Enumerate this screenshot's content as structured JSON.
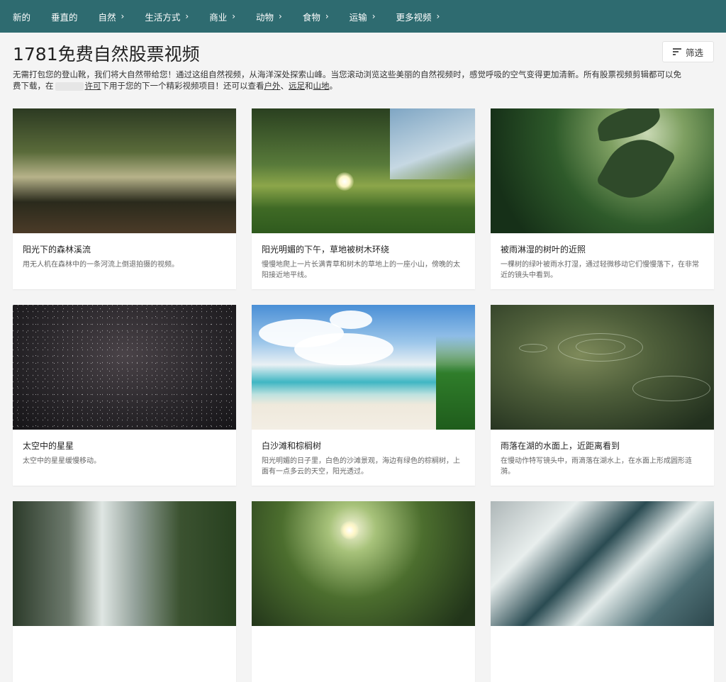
{
  "nav": {
    "items": [
      {
        "label": "新的",
        "has_chevron": false
      },
      {
        "label": "垂直的",
        "has_chevron": false
      },
      {
        "label": "自然",
        "has_chevron": true
      },
      {
        "label": "生活方式",
        "has_chevron": true
      },
      {
        "label": "商业",
        "has_chevron": true
      },
      {
        "label": "动物",
        "has_chevron": true
      },
      {
        "label": "食物",
        "has_chevron": true
      },
      {
        "label": "运输",
        "has_chevron": true
      },
      {
        "label": "更多视频",
        "has_chevron": true
      }
    ],
    "chevron_glyph": "›"
  },
  "header": {
    "title": "1781免费自然股票视频",
    "filter_label": "筛选",
    "filter_icon": "filter-lines-icon"
  },
  "description": {
    "text1": "无需打包您的登山靴，我们将大自然带给您！通过这组自然视频，从海洋深处探索山峰。当您滚动浏览这些美丽的自然视频时，感觉呼吸的空气变得更加清新。所有股票视频剪辑都可以免费下载，在",
    "link_license": "许可",
    "text2": "下用于您的下一个精彩视频项目！还可以查看",
    "link_outdoor": "户外",
    "sep1": "、",
    "link_hiking": "远足",
    "and": "和",
    "link_mountain": "山地",
    "end": "。"
  },
  "cards": [
    {
      "title": "阳光下的森林溪流",
      "desc": "用无人机在森林中的一条河流上倒退拍摄的视频。"
    },
    {
      "title": "阳光明媚的下午，草地被树木环绕",
      "desc": "慢慢地爬上一片长满青草和树木的草地上的一座小山，傍晚的太阳接近地平线。"
    },
    {
      "title": "被雨淋湿的树叶的近照",
      "desc": "一棵树的绿叶被雨水打湿，通过轻微移动它们慢慢落下，在非常近的镜头中看到。"
    },
    {
      "title": "太空中的星星",
      "desc": "太空中的星星缓慢移动。"
    },
    {
      "title": "白沙滩和棕榈树",
      "desc": "阳光明媚的日子里，白色的沙滩景观，海边有绿色的棕榈树，上面有一点多云的天空，阳光透过。"
    },
    {
      "title": "雨落在湖的水面上，近距离看到",
      "desc": "在慢动作特写镜头中，雨滴落在湖水上，在水面上形成圆形涟漪。"
    },
    {
      "title": "",
      "desc": ""
    },
    {
      "title": "",
      "desc": ""
    },
    {
      "title": "",
      "desc": ""
    }
  ],
  "colors": {
    "nav_bg": "#2e6b70",
    "page_bg": "#f4f4f4"
  }
}
